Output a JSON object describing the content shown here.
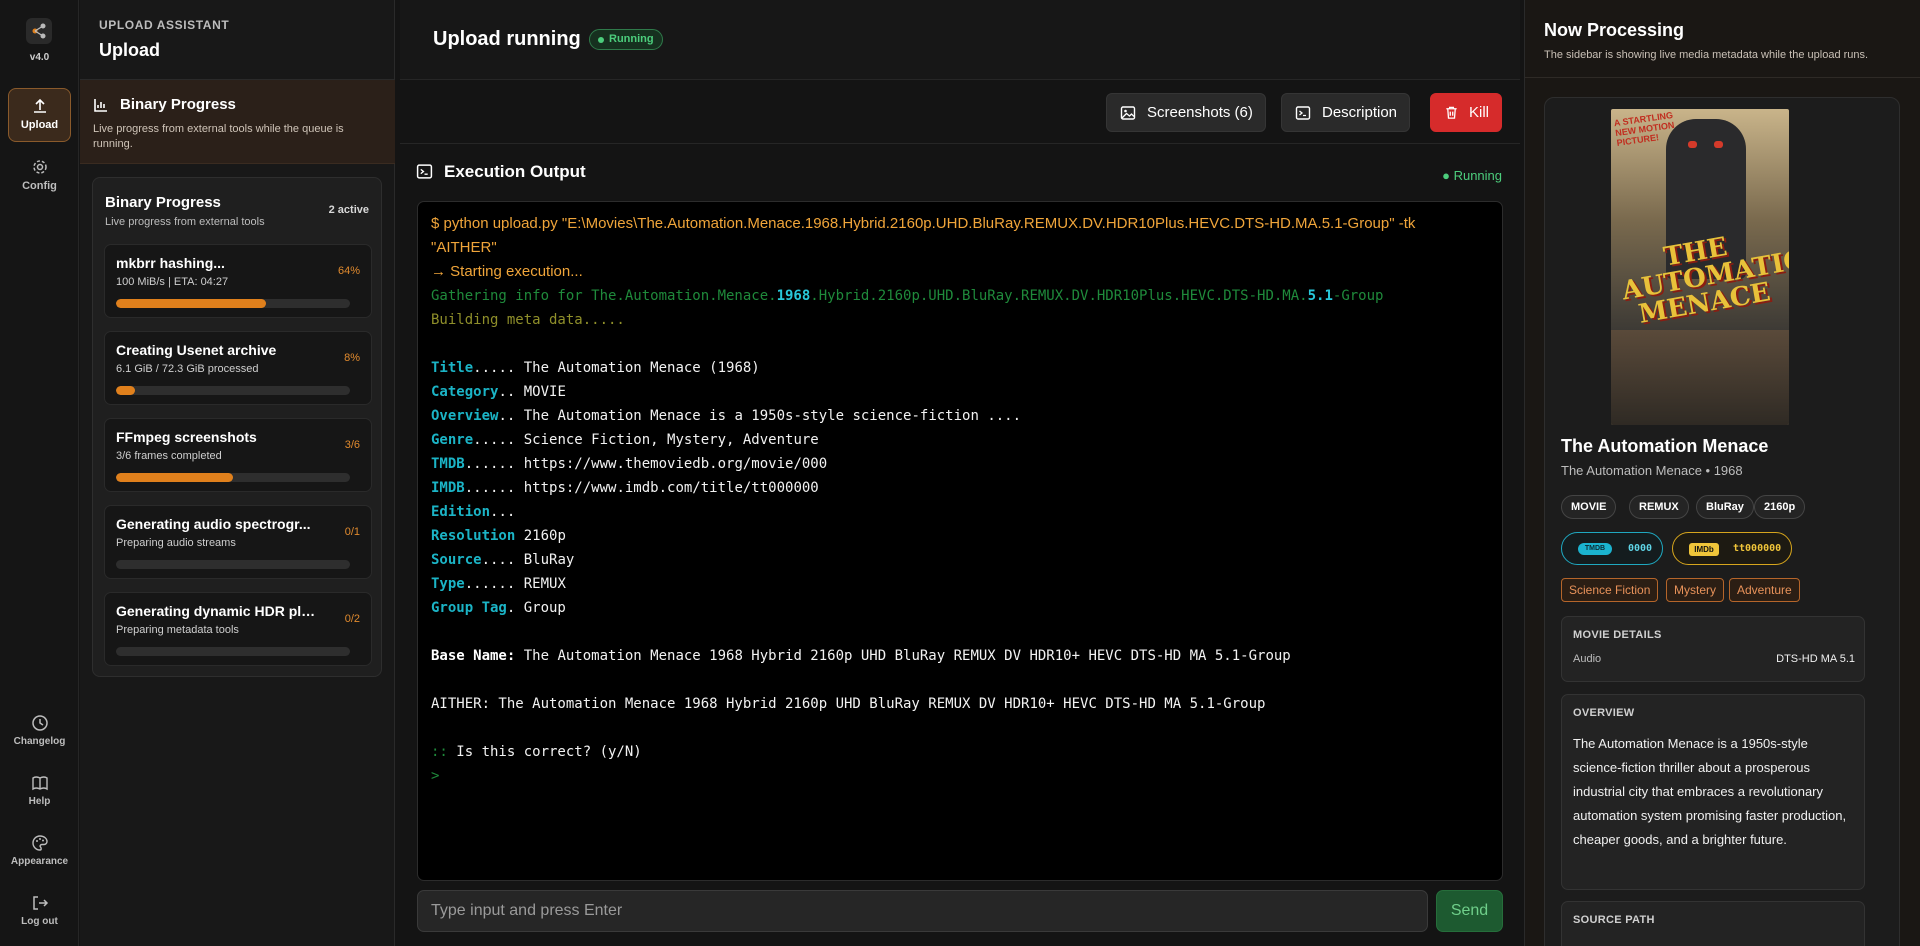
{
  "rail": {
    "version": "v4.0",
    "items": [
      {
        "label": "Upload",
        "icon": "upload-icon"
      },
      {
        "label": "Config",
        "icon": "gear-icon"
      }
    ],
    "bottom": [
      {
        "label": "Changelog",
        "icon": "clock-icon"
      },
      {
        "label": "Help",
        "icon": "book-icon"
      },
      {
        "label": "Appearance",
        "icon": "palette-icon"
      },
      {
        "label": "Log out",
        "icon": "logout-icon"
      }
    ]
  },
  "left_panel": {
    "kicker": "UPLOAD ASSISTANT",
    "title": "Upload",
    "section_title": "Binary Progress",
    "section_desc": "Live progress from external tools while the queue is running.",
    "card_title": "Binary Progress",
    "card_sub": "Live progress from external tools",
    "active": "2 active",
    "jobs": [
      {
        "title": "mkbrr hashing...",
        "sub": "100 MiB/s | ETA: 04:27",
        "pct": "64%",
        "progress": 0.64
      },
      {
        "title": "Creating Usenet archive",
        "sub": "6.1 GiB / 72.3 GiB processed",
        "pct": "8%",
        "progress": 0.08
      },
      {
        "title": "FFmpeg screenshots",
        "sub": "3/6 frames completed",
        "pct": "3/6",
        "progress": 0.5
      },
      {
        "title": "Generating audio spectrogr...",
        "sub": "Preparing audio streams",
        "pct": "0/1",
        "progress": 0
      },
      {
        "title": "Generating dynamic HDR plots",
        "sub": "Preparing metadata tools",
        "pct": "0/2",
        "progress": 0
      }
    ]
  },
  "main": {
    "title": "Upload running",
    "status_badge": "Running",
    "toolbar": {
      "screenshots": "Screenshots (6)",
      "description": "Description",
      "kill": "Kill"
    },
    "exec_title": "Execution Output",
    "exec_status": "● Running",
    "terminal": {
      "cmd1": "$ python upload.py \"E:\\Movies\\The.Automation.Menace.1968.Hybrid.2160p.UHD.BluRay.REMUX.DV.HDR10Plus.HEVC.DTS-HD.MA.5.1-Group\" -tk",
      "cmd2": "\"AITHER\"",
      "start": "→ Starting execution...",
      "gather_a": "Gathering info for The.Automation.Menace.",
      "gather_b": "1968",
      "gather_c": ".Hybrid.2160p.UHD.BluRay.REMUX.DV.HDR10Plus.HEVC.DTS-HD.MA.",
      "gather_d": "5.1",
      "gather_e": "-Group",
      "building": "Building meta data.....",
      "rows": [
        {
          "k": "Title",
          "dots": "..... ",
          "v": "The Automation Menace (1968)"
        },
        {
          "k": "Category",
          "dots": ".. ",
          "v": "MOVIE"
        },
        {
          "k": "Overview",
          "dots": ".. ",
          "v": "The Automation Menace is a 1950s-style science-fiction ...."
        },
        {
          "k": "Genre",
          "dots": "..... ",
          "v": "Science Fiction, Mystery, Adventure"
        },
        {
          "k": "TMDB",
          "dots": "...... ",
          "v": "https://www.themoviedb.org/movie/000"
        },
        {
          "k": "IMDB",
          "dots": "...... ",
          "v": "https://www.imdb.com/title/tt000000"
        },
        {
          "k": "Edition",
          "dots": "...",
          "v": ""
        },
        {
          "k": "Resolution",
          "dots": " ",
          "v": "2160p"
        },
        {
          "k": "Source",
          "dots": ".... ",
          "v": "BluRay"
        },
        {
          "k": "Type",
          "dots": "...... ",
          "v": "REMUX"
        },
        {
          "k": "Group Tag",
          "dots": ". ",
          "v": "Group"
        }
      ],
      "base_label": "Base Name:",
      "base_value": " The Automation Menace 1968 Hybrid 2160p UHD BluRay REMUX DV HDR10+ HEVC DTS-HD MA 5.1-Group",
      "aither": "AITHER: The Automation Menace 1968 Hybrid 2160p UHD BluRay REMUX DV HDR10+ HEVC DTS-HD MA 5.1-Group",
      "prompt_mark": "::",
      "prompt": " Is this correct? (y/N)",
      "caret": ">"
    },
    "input_placeholder": "Type input and press Enter",
    "send": "Send"
  },
  "right_panel": {
    "title": "Now Processing",
    "subtitle": "The sidebar is showing live media metadata while the upload runs.",
    "poster": {
      "tagline": "A STARTLING NEW MOTION PICTURE!",
      "title": "THE AUTOMATION MENACE"
    },
    "movie_title": "The Automation Menace",
    "movie_sub": "The Automation Menace • 1968",
    "pills": [
      "MOVIE",
      "REMUX",
      "BluRay",
      "2160p"
    ],
    "tmdb_logo": "TMDB",
    "tmdb_id": "0000",
    "imdb_logo": "IMDb",
    "imdb_id": "tt000000",
    "genres": [
      "Science Fiction",
      "Mystery",
      "Adventure"
    ],
    "details_title": "MOVIE DETAILS",
    "audio_label": "Audio",
    "audio_value": "DTS-HD MA 5.1",
    "overview_title": "OVERVIEW",
    "overview": "The Automation Menace is a 1950s-style science-fiction thriller about a prosperous industrial city that embraces a revolutionary automation system promising faster production, cheaper goods, and a brighter future.",
    "source_title": "SOURCE PATH"
  }
}
